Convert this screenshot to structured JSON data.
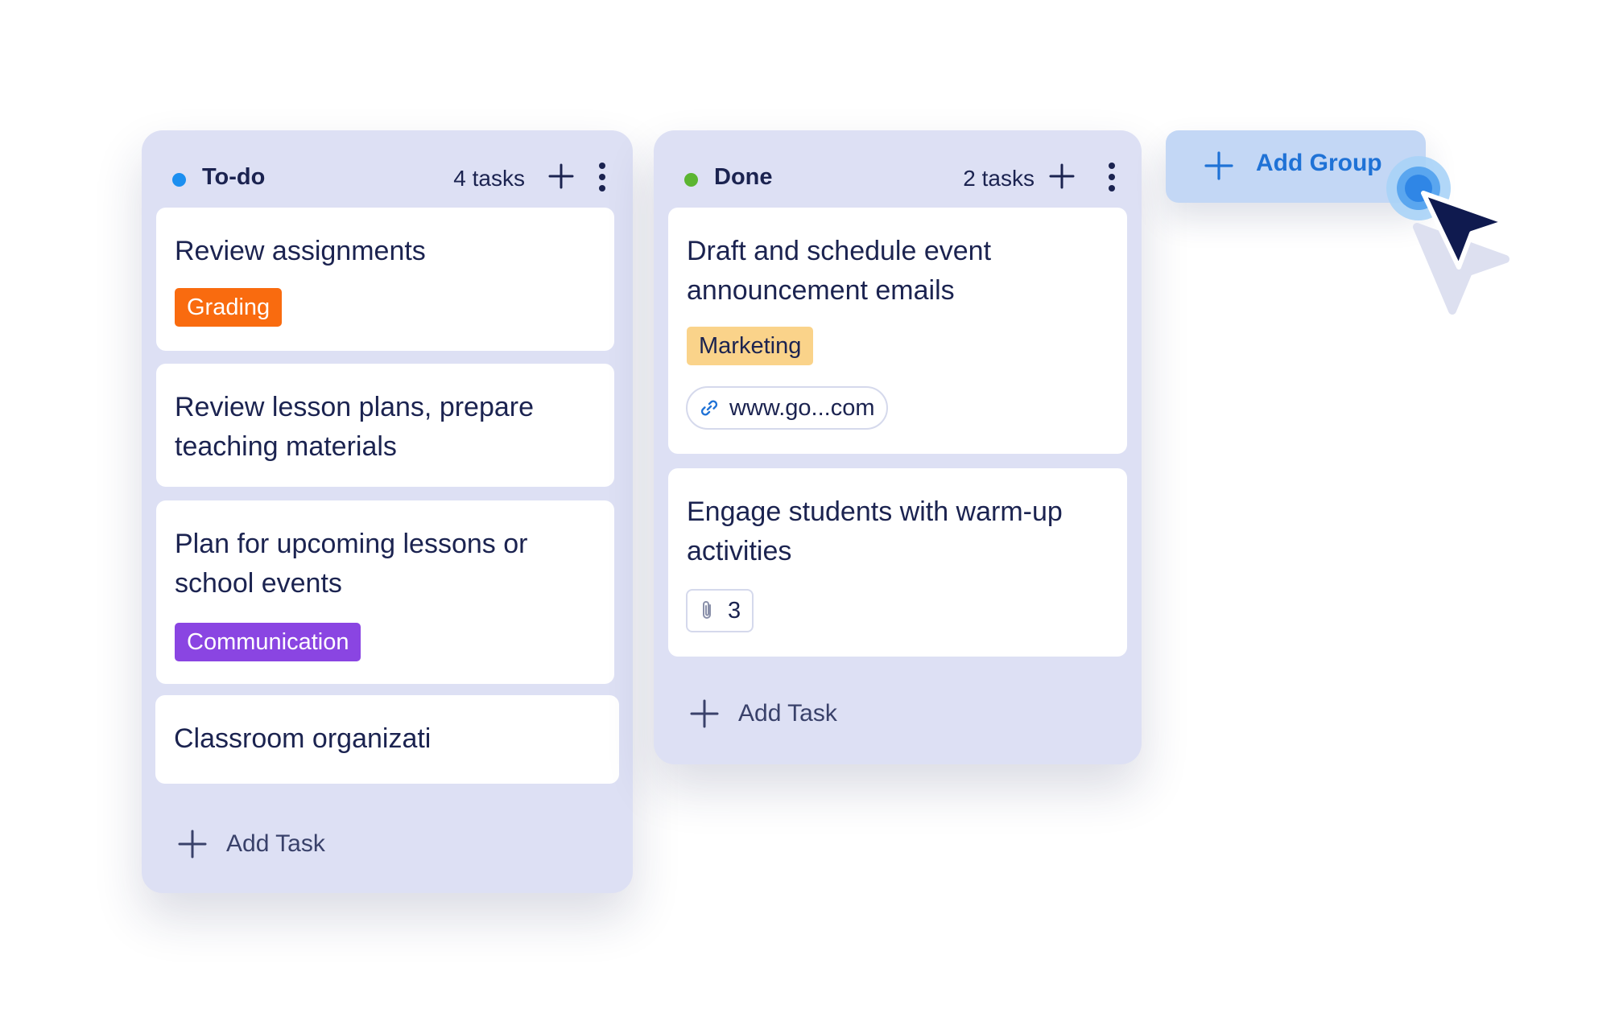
{
  "columns": [
    {
      "title": "To-do",
      "dot_color": "#1c8ff0",
      "task_count": "4 tasks",
      "add_icon": "plus-icon",
      "menu_icon": "kebab-menu-icon",
      "cards": [
        {
          "title": "Review assignments",
          "tag": "Grading",
          "tag_color": "#f96b0f"
        },
        {
          "title": "Review lesson plans, prepare teaching materials"
        },
        {
          "title": "Plan for upcoming lessons or school events",
          "tag": "Communication",
          "tag_color": "#8a45e2"
        },
        {
          "title": "Classroom organizati"
        }
      ],
      "add_task_label": "Add Task"
    },
    {
      "title": "Done",
      "dot_color": "#5bb531",
      "task_count": "2 tasks",
      "add_icon": "plus-icon",
      "menu_icon": "kebab-menu-icon",
      "cards": [
        {
          "title": "Draft and schedule event announcement emails",
          "tag": "Marketing",
          "tag_color": "#fad38a",
          "link": "www.go...com",
          "link_icon": "link-icon"
        },
        {
          "title": "Engage students with warm-up activities",
          "attachments": "3",
          "attachment_icon": "paperclip-icon"
        }
      ],
      "add_task_label": "Add Task"
    }
  ],
  "add_group": {
    "label": "Add Group",
    "icon": "plus-icon",
    "color": "#1f72d6"
  },
  "cursor": {
    "icon": "mouse-pointer-icon",
    "color": "#0f1a4f"
  }
}
